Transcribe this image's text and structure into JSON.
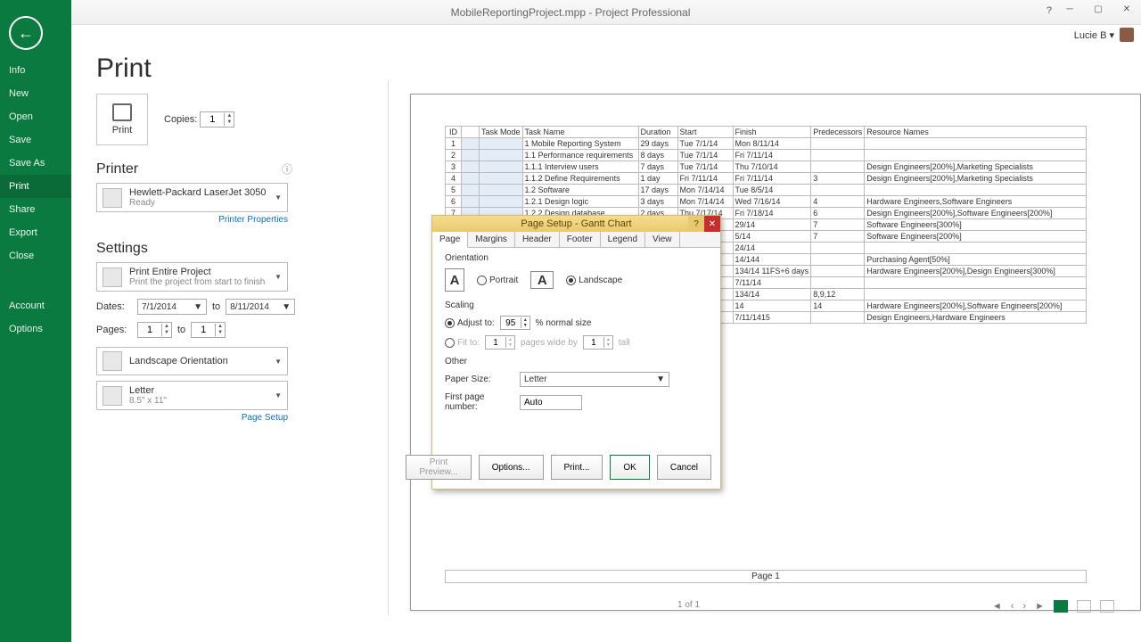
{
  "titlebar": {
    "title": "MobileReportingProject.mpp - Project Professional"
  },
  "user": {
    "name": "Lucie B ▾"
  },
  "sidebar": {
    "items": [
      {
        "label": "Info"
      },
      {
        "label": "New"
      },
      {
        "label": "Open"
      },
      {
        "label": "Save"
      },
      {
        "label": "Save As"
      },
      {
        "label": "Print",
        "selected": true
      },
      {
        "label": "Share"
      },
      {
        "label": "Export"
      },
      {
        "label": "Close"
      }
    ],
    "bottom": [
      {
        "label": "Account"
      },
      {
        "label": "Options"
      }
    ]
  },
  "page": {
    "title": "Print"
  },
  "print": {
    "button_label": "Print",
    "copies_label": "Copies:",
    "copies_value": "1"
  },
  "printer": {
    "heading": "Printer",
    "name": "Hewlett-Packard LaserJet 3050",
    "status": "Ready",
    "properties_link": "Printer Properties"
  },
  "settings": {
    "heading": "Settings",
    "scope": {
      "main": "Print Entire Project",
      "sub": "Print the project from start to finish"
    },
    "dates_label": "Dates:",
    "date_from": "7/1/2014",
    "date_to_label": "to",
    "date_to": "8/11/2014",
    "pages_label": "Pages:",
    "page_from": "1",
    "page_to_label": "to",
    "page_to": "1",
    "orientation": {
      "main": "Landscape Orientation",
      "sub": ""
    },
    "paper": {
      "main": "Letter",
      "sub": "8.5\" x 11\""
    },
    "page_setup_link": "Page Setup"
  },
  "preview": {
    "page_label": "Page 1",
    "page_count": "1 of 1",
    "columns": [
      "ID",
      "",
      "Task Mode",
      "Task Name",
      "Duration",
      "Start",
      "Finish",
      "Predecessors",
      "Resource Names"
    ],
    "rows": [
      {
        "id": "1",
        "name": "1 Mobile Reporting System",
        "dur": "29 days",
        "start": "Tue 7/1/14",
        "finish": "Mon 8/11/14",
        "pred": "",
        "res": ""
      },
      {
        "id": "2",
        "name": "  1.1 Performance requirements",
        "dur": "8 days",
        "start": "Tue 7/1/14",
        "finish": "Fri 7/11/14",
        "pred": "",
        "res": ""
      },
      {
        "id": "3",
        "name": "    1.1.1 Interview users",
        "dur": "7 days",
        "start": "Tue 7/1/14",
        "finish": "Thu 7/10/14",
        "pred": "",
        "res": "Design Engineers[200%],Marketing Specialists"
      },
      {
        "id": "4",
        "name": "    1.1.2 Define Requirements",
        "dur": "1 day",
        "start": "Fri 7/11/14",
        "finish": "Fri 7/11/14",
        "pred": "3",
        "res": "Design Engineers[200%],Marketing Specialists"
      },
      {
        "id": "5",
        "name": "  1.2 Software",
        "dur": "17 days",
        "start": "Mon 7/14/14",
        "finish": "Tue 8/5/14",
        "pred": "",
        "res": ""
      },
      {
        "id": "6",
        "name": "    1.2.1 Design logic",
        "dur": "3 days",
        "start": "Mon 7/14/14",
        "finish": "Wed 7/16/14",
        "pred": "4",
        "res": "Hardware Engineers,Software Engineers"
      },
      {
        "id": "7",
        "name": "    1.2.2 Design database",
        "dur": "2 days",
        "start": "Thu 7/17/14",
        "finish": "Fri 7/18/14",
        "pred": "6",
        "res": "Design Engineers[200%],Software Engineers[200%]"
      },
      {
        "id": "",
        "name": "",
        "dur": "",
        "start": "",
        "finish": "29/14",
        "pred": "7",
        "res": "Software Engineers[300%]"
      },
      {
        "id": "",
        "name": "",
        "dur": "",
        "start": "",
        "finish": "5/14",
        "pred": "7",
        "res": "Software Engineers[200%]"
      },
      {
        "id": "",
        "name": "",
        "dur": "",
        "start": "",
        "finish": "24/14",
        "pred": "",
        "res": ""
      },
      {
        "id": "",
        "name": "",
        "dur": "",
        "start": "",
        "finish": "14/144",
        "pred": "",
        "res": "Purchasing Agent[50%]"
      },
      {
        "id": "",
        "name": "",
        "dur": "",
        "start": "",
        "finish": "134/14 11FS+6 days",
        "pred": "",
        "res": "Hardware Engineers[200%],Design Engineers[300%]"
      },
      {
        "id": "",
        "name": "",
        "dur": "",
        "start": "",
        "finish": "7/11/14",
        "pred": "",
        "res": ""
      },
      {
        "id": "",
        "name": "",
        "dur": "",
        "start": "",
        "finish": "134/14",
        "pred": "8,9,12",
        "res": ""
      },
      {
        "id": "",
        "name": "",
        "dur": "",
        "start": "",
        "finish": "14",
        "pred": "14",
        "res": "Hardware Engineers[200%],Software Engineers[200%]"
      },
      {
        "id": "",
        "name": "",
        "dur": "",
        "start": "",
        "finish": "7/11/1415",
        "pred": "",
        "res": "Design Engineers,Hardware Engineers"
      }
    ]
  },
  "dialog": {
    "title": "Page Setup - Gantt Chart",
    "tabs": [
      "Page",
      "Margins",
      "Header",
      "Footer",
      "Legend",
      "View"
    ],
    "orientation": {
      "heading": "Orientation",
      "portrait": "Portrait",
      "landscape": "Landscape"
    },
    "scaling": {
      "heading": "Scaling",
      "adjust_to": "Adjust to:",
      "adjust_value": "95",
      "normal_size": "% normal size",
      "fit_to": "Fit to:",
      "fit_wide": "1",
      "fit_wide_label": "pages wide by",
      "fit_tall": "1",
      "fit_tall_label": "tall"
    },
    "other": {
      "heading": "Other",
      "paper_size_label": "Paper Size:",
      "paper_size_value": "Letter",
      "first_page_label": "First page number:",
      "first_page_value": "Auto"
    },
    "buttons": {
      "preview": "Print Preview...",
      "options": "Options...",
      "print": "Print...",
      "ok": "OK",
      "cancel": "Cancel"
    }
  }
}
